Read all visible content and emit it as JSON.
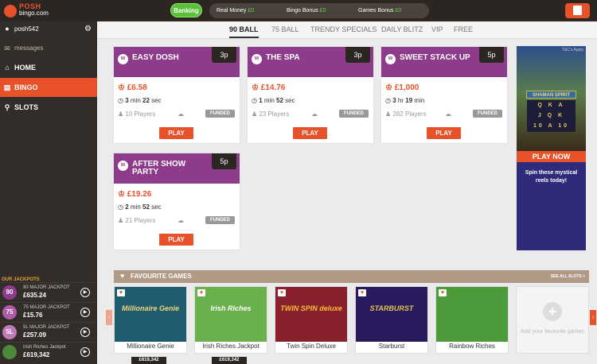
{
  "logo": {
    "line1": "POSH",
    "line2": "bingo",
    "line3": ".com"
  },
  "header": {
    "banking_label": "Banking",
    "balances": [
      {
        "label": "Real Money",
        "value": "£0"
      },
      {
        "label": "Bingo Bonus",
        "value": "£0"
      },
      {
        "label": "Games Bonus",
        "value": "£0"
      }
    ],
    "gift_icon": "gift-icon"
  },
  "sidebar": {
    "username": "posh542",
    "messages": "messages",
    "nav": [
      {
        "label": "HOME",
        "icon": "home-icon"
      },
      {
        "label": "BINGO",
        "icon": "bingo-ticket-icon"
      },
      {
        "label": "SLOTS",
        "icon": "slots-icon"
      }
    ],
    "jackpots_title": "OUR JACKPOTS",
    "jackpots": [
      {
        "badge": "90",
        "name": "90 MAJOR JACKPOT",
        "amount": "£635.24",
        "color": "#8e3b8c"
      },
      {
        "badge": "75",
        "name": "75 MAJOR JACKPOT",
        "amount": "£15.76",
        "color": "#b05aa8"
      },
      {
        "badge": "5L",
        "name": "5L MAJOR JACKPOT",
        "amount": "£257.09",
        "color": "#c27ab9"
      },
      {
        "badge": "",
        "name": "Irish Riches Jackpot",
        "amount": "£619,342",
        "color": "#4a8a3a"
      }
    ]
  },
  "tabs": [
    "90 BALL",
    "75 BALL",
    "TRENDY SPECIALS",
    "DAILY BLITZ",
    "VIP",
    "FREE"
  ],
  "rooms": [
    {
      "ball": "90",
      "title": "EASY DOSH",
      "price": "3p",
      "jackpot": "£6.58",
      "time_a": "3",
      "time_a_unit": "min",
      "time_b": "22",
      "time_b_unit": "sec",
      "players": "10 Players",
      "funded": "FUNDED",
      "play": "PLAY"
    },
    {
      "ball": "90",
      "title": "THE SPA",
      "price": "3p",
      "jackpot": "£14.76",
      "time_a": "1",
      "time_a_unit": "min",
      "time_b": "52",
      "time_b_unit": "sec",
      "players": "23 Players",
      "funded": "FUNDED",
      "play": "PLAY"
    },
    {
      "ball": "90",
      "title": "SWEET STACK UP",
      "price": "5p",
      "jackpot": "£1,000",
      "time_a": "3",
      "time_a_unit": "hr",
      "time_b": "19",
      "time_b_unit": "min",
      "players": "282 Players",
      "funded": "FUNDED",
      "play": "PLAY"
    },
    {
      "ball": "90",
      "title": "AFTER SHOW PARTY",
      "price": "5p",
      "jackpot": "£19.26",
      "time_a": "2",
      "time_a_unit": "min",
      "time_b": "52",
      "time_b_unit": "sec",
      "players": "21 Players",
      "funded": "FUNDED",
      "play": "PLAY"
    }
  ],
  "promo": {
    "tc": "T&C's Apply",
    "game_title": "SHAMAN SPIRIT",
    "play_now": "PLAY NOW",
    "tagline": "Spin these mystical reels today!"
  },
  "favourites": {
    "title": "FAVOURITE GAMES",
    "see_all": "SEE ALL SLOTS >",
    "games": [
      {
        "name": "Millionaire Genie",
        "art": "Millionaire Genie",
        "bg": "#1f5c6e",
        "fg": "#f2d47a"
      },
      {
        "name": "Irish Riches Jackpot",
        "art": "Irish Riches",
        "bg": "#6ab04c",
        "fg": "#ffffff"
      },
      {
        "name": "Twin Spin Deluxe",
        "art": "TWIN SPIN deluxe",
        "bg": "#8a1f2e",
        "fg": "#f2c12e"
      },
      {
        "name": "Starburst",
        "art": "STARBURST",
        "bg": "#2a1a5e",
        "fg": "#e0c44a"
      },
      {
        "name": "Rainbow Riches",
        "art": "",
        "bg": "#4c9a3a",
        "fg": "#ffffff"
      }
    ],
    "add_label": "Add your favourite games",
    "jackpot_badges": [
      "£619,342",
      "£619,342"
    ]
  }
}
